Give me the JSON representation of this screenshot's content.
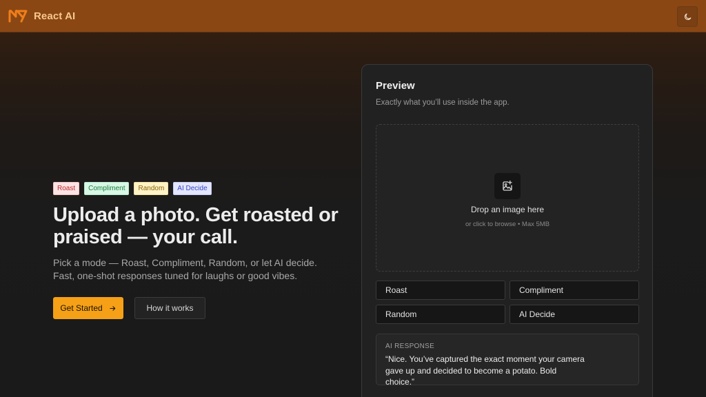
{
  "header": {
    "brand": "React AI",
    "logo_icon": "react-ai-logo",
    "theme_icon": "moon-icon"
  },
  "hero": {
    "badges": [
      "Roast",
      "Compliment",
      "Random",
      "AI Decide"
    ],
    "headline_line1": "Upload a photo. Get roasted or",
    "headline_line2": "praised — your call.",
    "subtitle_line1": "Pick a mode — Roast, Compliment, Random, or let AI decide.",
    "subtitle_line2": "Fast, one-shot responses tuned for laughs or good vibes.",
    "primary_cta": "Get Started",
    "primary_cta_icon": "arrow-right-icon",
    "secondary_cta": "How it works"
  },
  "preview": {
    "title": "Preview",
    "subtitle": "Exactly what you’ll use inside the app.",
    "dropzone": {
      "icon": "image-plus-icon",
      "title": "Drop an image here",
      "hint": "or click to browse • Max 5MB"
    },
    "modes": [
      "Roast",
      "Compliment",
      "Random",
      "AI Decide"
    ],
    "response_label": "AI RESPONSE",
    "response_text": "“Nice. You’ve captured the exact moment your camera gave up and decided to become a potato. Bold choice.”"
  },
  "colors": {
    "header_bg": "#8a4714",
    "brand_text": "#f7c88f",
    "primary_button": "#f5a016",
    "card_bg": "#212121"
  }
}
